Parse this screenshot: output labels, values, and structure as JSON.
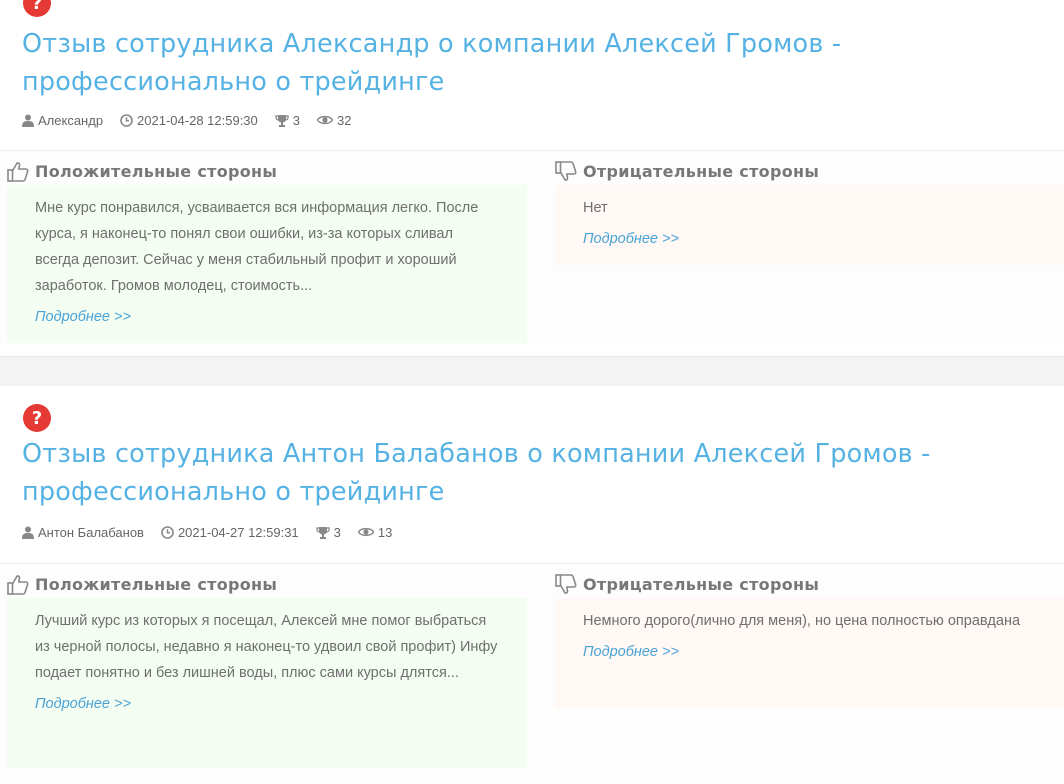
{
  "reviews": [
    {
      "title": "Отзыв сотрудника Александр о компании Алексей Громов - профессионально о трейдинге",
      "author": "Александр",
      "date": "2021-04-28 12:59:30",
      "trophies": "3",
      "views": "32",
      "positive_heading": "Положительные стороны",
      "positive_text": "Мне курс понравился, усваивается вся информация легко. После курса, я наконец-то понял свои ошибки, из-за которых сливал всегда депозит. Сейчас у меня стабильный профит и хороший заработок. Громов молодец, стоимость...",
      "negative_heading": "Отрицательные стороны",
      "negative_text": "Нет",
      "more_label": "Подробнее >>"
    },
    {
      "title": "Отзыв сотрудника Антон Балабанов о компании Алексей Громов - профессионально о трейдинге",
      "author": "Антон Балабанов",
      "date": "2021-04-27 12:59:31",
      "trophies": "3",
      "views": "13",
      "positive_heading": "Положительные стороны",
      "positive_text": "Лучший курс из которых я посещал, Алексей мне помог выбраться из черной полосы, недавно я наконец-то удвоил свой профит)  Инфу подает понятно и без лишней воды, плюс сами курсы длятся...",
      "negative_heading": "Отрицательные стороны",
      "negative_text": "Немного дорого(лично для меня), но цена полностью оправдана",
      "more_label": "Подробнее >>"
    }
  ],
  "icons": {
    "status": "question-mark-icon",
    "author": "user-icon",
    "date": "clock-icon",
    "trophies": "trophy-icon",
    "views": "eye-icon",
    "positive": "thumbs-up-icon",
    "negative": "thumbs-down-icon"
  },
  "colors": {
    "title": "#55b2e3",
    "link": "#4aa3d6",
    "status_icon": "#e53935",
    "positive_bg": "#f4fdf2",
    "negative_bg": "#fff8f4"
  }
}
